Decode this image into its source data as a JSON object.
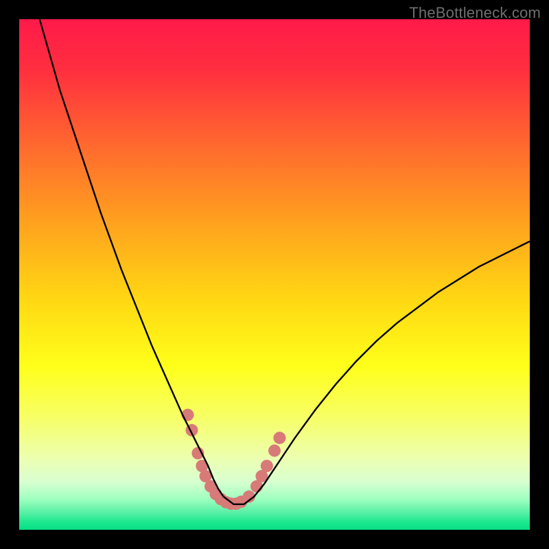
{
  "watermark": "TheBottleneck.com",
  "chart_data": {
    "type": "line",
    "title": "",
    "xlabel": "",
    "ylabel": "",
    "xlim": [
      0,
      100
    ],
    "ylim": [
      0,
      100
    ],
    "gradient_stops": [
      {
        "offset": 0.0,
        "color": "#ff1a49"
      },
      {
        "offset": 0.1,
        "color": "#ff2f3f"
      },
      {
        "offset": 0.25,
        "color": "#ff6a2e"
      },
      {
        "offset": 0.4,
        "color": "#ffa21e"
      },
      {
        "offset": 0.55,
        "color": "#ffd813"
      },
      {
        "offset": 0.68,
        "color": "#ffff1a"
      },
      {
        "offset": 0.78,
        "color": "#f7ff66"
      },
      {
        "offset": 0.86,
        "color": "#ecffb0"
      },
      {
        "offset": 0.905,
        "color": "#d9ffd0"
      },
      {
        "offset": 0.94,
        "color": "#9effc0"
      },
      {
        "offset": 0.965,
        "color": "#5cf0a6"
      },
      {
        "offset": 0.985,
        "color": "#1de88f"
      },
      {
        "offset": 1.0,
        "color": "#06e085"
      }
    ],
    "series": [
      {
        "name": "curve",
        "color": "#000000",
        "x": [
          4,
          6,
          8,
          10,
          12,
          14,
          16,
          18,
          20,
          22,
          24,
          26,
          28,
          30,
          32,
          34,
          35.5,
          37,
          38,
          39,
          40,
          42,
          44,
          46,
          48,
          50,
          54,
          58,
          62,
          66,
          70,
          74,
          78,
          82,
          86,
          90,
          94,
          98,
          100
        ],
        "y": [
          100,
          93,
          86,
          80,
          74,
          68,
          62,
          56.5,
          51,
          46,
          41,
          36,
          31.5,
          27,
          22.5,
          18.5,
          15.5,
          12.5,
          10,
          8,
          6.5,
          5,
          5,
          6.5,
          9,
          12,
          18,
          23.5,
          28.5,
          33,
          37,
          40.5,
          43.5,
          46.5,
          49,
          51.5,
          53.5,
          55.5,
          56.5
        ]
      }
    ],
    "dots": {
      "color": "#d77a78",
      "points": [
        {
          "x": 33.0,
          "y": 22.5
        },
        {
          "x": 33.8,
          "y": 19.5
        },
        {
          "x": 35.0,
          "y": 15.0
        },
        {
          "x": 35.8,
          "y": 12.5
        },
        {
          "x": 36.5,
          "y": 10.5
        },
        {
          "x": 37.5,
          "y": 8.5
        },
        {
          "x": 38.5,
          "y": 7.0
        },
        {
          "x": 39.5,
          "y": 6.0
        },
        {
          "x": 40.5,
          "y": 5.4
        },
        {
          "x": 41.5,
          "y": 5.1
        },
        {
          "x": 42.5,
          "y": 5.1
        },
        {
          "x": 43.5,
          "y": 5.5
        },
        {
          "x": 45.0,
          "y": 6.5
        },
        {
          "x": 46.5,
          "y": 8.5
        },
        {
          "x": 47.5,
          "y": 10.5
        },
        {
          "x": 48.5,
          "y": 12.5
        },
        {
          "x": 50.0,
          "y": 15.5
        },
        {
          "x": 51.0,
          "y": 18.0
        }
      ],
      "radius": 9
    }
  }
}
